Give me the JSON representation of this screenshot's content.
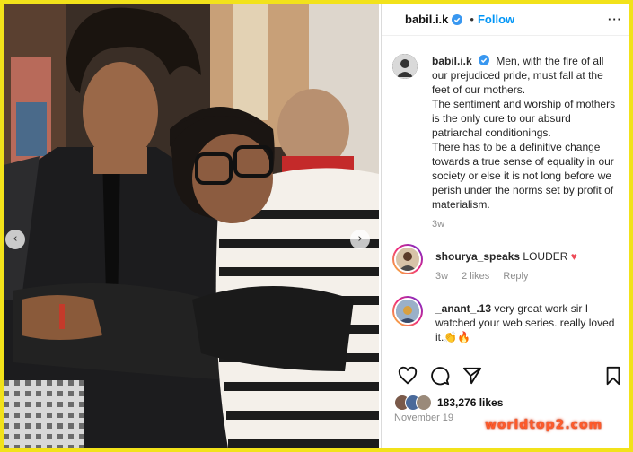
{
  "post": {
    "username": "babil.i.k",
    "separator": "•",
    "follow_label": "Follow",
    "more_label": "···",
    "caption_username": "babil.i.k",
    "caption_lines": [
      "Men, with the fire of all our prejudiced pride, must fall at the feet of our mothers.",
      "The sentiment and worship of mothers is the only cure to our absurd patriarchal conditionings.",
      "There has to be a definitive change towards a true sense of equality in our society or else it is not long before we perish under the norms set by profit of materialism."
    ],
    "caption_age": "3w"
  },
  "comments": [
    {
      "username": "shourya_speaks",
      "text": "LOUDER",
      "emoji": "♥",
      "age": "3w",
      "likes": "2 likes",
      "reply": "Reply"
    },
    {
      "username": "_anant_.13",
      "text": "very great work sir I watched your web series. really loved it.",
      "emoji": "👏🔥"
    }
  ],
  "actions": {
    "like_icon": "heart-outline-icon",
    "comment_icon": "comment-bubble-icon",
    "share_icon": "paper-plane-icon",
    "save_icon": "bookmark-icon"
  },
  "likes_count": "183,276 likes",
  "date": "November 19",
  "watermark": "worldtop2.com",
  "colors": {
    "follow": "#0095f6",
    "verified": "#3897f0",
    "frame": "#f2e21a",
    "heart": "#ed4956",
    "watermark": "#ff5a2a"
  }
}
